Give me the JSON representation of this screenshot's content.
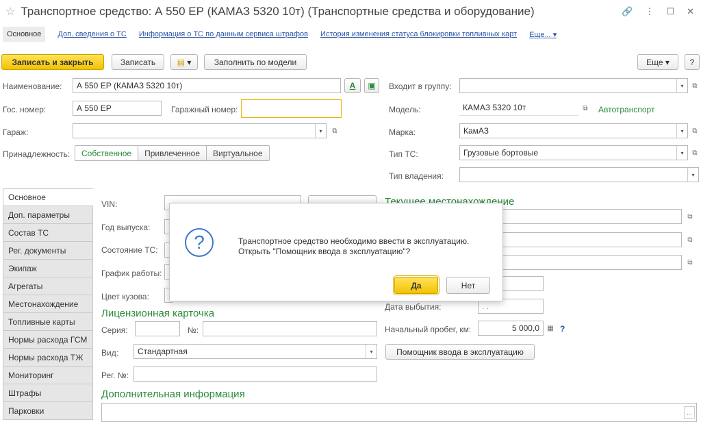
{
  "window": {
    "title": "Транспортное средство: А 550 ЕР (КАМАЗ 5320 10т) (Транспортные средства и оборудование)"
  },
  "nav": {
    "items": [
      "Основное",
      "Доп. сведения о ТС",
      "Информация о ТС по данным сервиса штрафов",
      "История изменения статуса блокировки топливных карт",
      "Еще..."
    ]
  },
  "toolbar": {
    "save_close": "Записать и закрыть",
    "save": "Записать",
    "fill_by_model": "Заполнить по модели",
    "more": "Еще",
    "help": "?"
  },
  "form": {
    "name_label": "Наименование:",
    "name_value": "А 550 ЕР (КАМАЗ 5320 10т)",
    "gos_label": "Гос. номер:",
    "gos_value": "А 550 ЕР",
    "garage_num_label": "Гаражный номер:",
    "garage_num_value": "",
    "garage_label": "Гараж:",
    "garage_value": "",
    "belong_label": "Принадлежность:",
    "belong_options": [
      "Собственное",
      "Привлеченное",
      "Виртуальное"
    ],
    "group_label": "Входит в группу:",
    "group_value": "",
    "model_label": "Модель:",
    "model_value": "КАМАЗ 5320 10т",
    "model_type": "Автотранспорт",
    "brand_label": "Марка:",
    "brand_value": "КамАЗ",
    "type_label": "Тип ТС:",
    "type_value": "Грузовые бортовые",
    "own_label": "Тип владения:",
    "own_value": ""
  },
  "tabs": [
    "Основное",
    "Доп. параметры",
    "Состав ТС",
    "Рег. документы",
    "Экипаж",
    "Агрегаты",
    "Местонахождение",
    "Топливные карты",
    "Нормы расхода ГСМ",
    "Нормы расхода ТЖ",
    "Мониторинг",
    "Штрафы",
    "Парковки"
  ],
  "main": {
    "vin_label": "VIN:",
    "year_label": "Год выпуска:",
    "state_label": "Состояние ТС:",
    "schedule_label": "График работы:",
    "color_label": "Цвет кузова:",
    "location_title": "Текущее местонахождение",
    "disposal_label": "Дата выбытия:",
    "disposal_value": ". .",
    "mileage_label": "Начальный пробег, км:",
    "mileage_value": "5 000,0",
    "mileage_help": "?",
    "license_title": "Лицензионная карточка",
    "series_label": "Серия:",
    "number_label": "№:",
    "kind_label": "Вид:",
    "kind_value": "Стандартная",
    "reg_label": "Рег. №:",
    "assistant_button": "Помощник ввода в эксплуатацию",
    "extra_title": "Дополнительная информация"
  },
  "dialog": {
    "line1": "Транспортное средство необходимо ввести в эксплуатацию.",
    "line2": "Открыть \"Помощник ввода  в эксплуатацию\"?",
    "yes": "Да",
    "no": "Нет"
  }
}
